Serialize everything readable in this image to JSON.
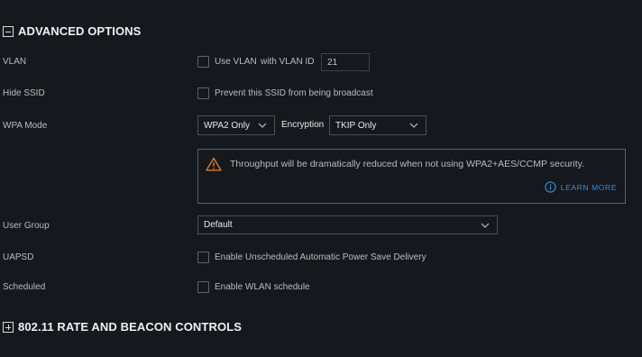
{
  "advanced": {
    "title": "ADVANCED OPTIONS",
    "vlan": {
      "label": "VLAN",
      "checkbox_label": "Use VLAN",
      "with_label": "with VLAN ID",
      "id_value": "21"
    },
    "hide_ssid": {
      "label": "Hide SSID",
      "checkbox_label": "Prevent this SSID from being broadcast"
    },
    "wpa_mode": {
      "label": "WPA Mode",
      "value": "WPA2 Only",
      "encryption_label": "Encryption",
      "encryption_value": "TKIP Only"
    },
    "warning": {
      "text": "Throughput will be dramatically reduced when not using WPA2+AES/CCMP security.",
      "link": "LEARN MORE"
    },
    "user_group": {
      "label": "User Group",
      "value": "Default"
    },
    "uapsd": {
      "label": "UAPSD",
      "checkbox_label": "Enable Unscheduled Automatic Power Save Delivery"
    },
    "scheduled": {
      "label": "Scheduled",
      "checkbox_label": "Enable WLAN schedule"
    }
  },
  "rate_beacon": {
    "title": "802.11 RATE AND BEACON CONTROLS"
  },
  "colors": {
    "background": "#15181d",
    "accent": "#3a8fe0",
    "warning": "#e07b2a"
  }
}
